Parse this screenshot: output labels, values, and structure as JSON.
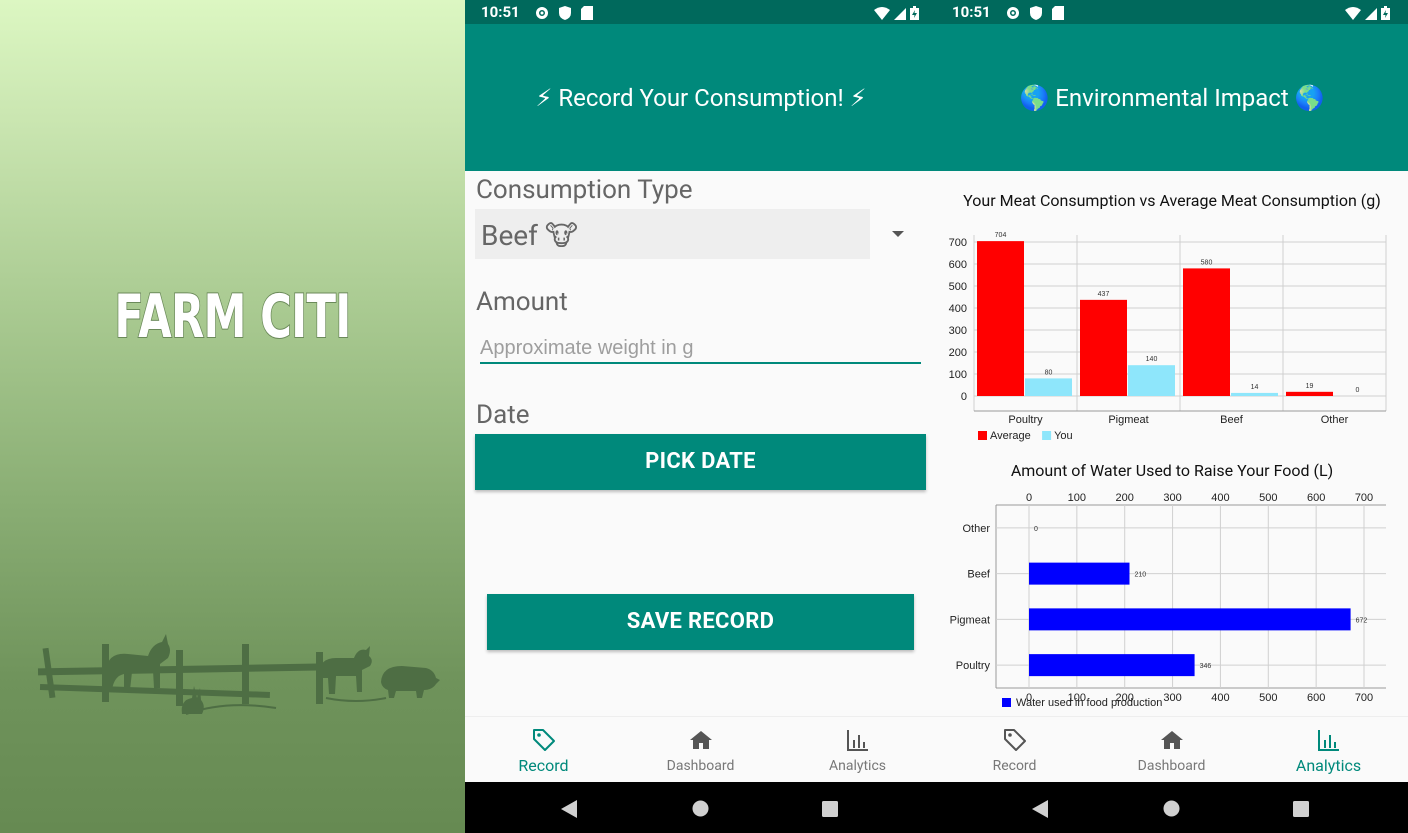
{
  "splash": {
    "app_title": "FARM CITI"
  },
  "status_bar": {
    "time": "10:51"
  },
  "record_screen": {
    "header_title": "⚡ Record Your Consumption! ⚡",
    "consumption_type_label": "Consumption Type",
    "consumption_type_value": "Beef 🐮",
    "amount_label": "Amount",
    "amount_placeholder": "Approximate weight in g",
    "amount_value": "",
    "date_label": "Date",
    "pick_date_button": "PICK DATE",
    "save_record_button": "SAVE RECORD"
  },
  "analytics_screen": {
    "header_title": "🌎 Environmental Impact 🌎"
  },
  "bottom_nav": {
    "items": [
      {
        "label": "Record",
        "icon": "tag-icon"
      },
      {
        "label": "Dashboard",
        "icon": "home-icon"
      },
      {
        "label": "Analytics",
        "icon": "bar-chart-icon"
      }
    ]
  },
  "colors": {
    "primary": "#00897b",
    "primary_dark": "#00695c",
    "average_bar": "#ff0000",
    "you_bar": "#8ee6fb",
    "water_bar": "#0000ff"
  },
  "chart_data": [
    {
      "type": "bar",
      "title": "Your Meat Consumption vs Average Meat Consumption (g)",
      "categories": [
        "Poultry",
        "Pigmeat",
        "Beef",
        "Other"
      ],
      "series": [
        {
          "name": "Average",
          "values": [
            704,
            437,
            580,
            19
          ],
          "color": "#ff0000"
        },
        {
          "name": "You",
          "values": [
            80,
            140,
            14,
            0
          ],
          "color": "#8ee6fb"
        }
      ],
      "ylim": [
        0,
        700
      ],
      "yticks": [
        0,
        100,
        200,
        300,
        400,
        500,
        600,
        700
      ],
      "grid": true,
      "legend": "bottom-left"
    },
    {
      "type": "bar",
      "orientation": "horizontal",
      "title": "Amount of Water Used to Raise Your Food (L)",
      "categories": [
        "Poultry",
        "Pigmeat",
        "Beef",
        "Other"
      ],
      "series": [
        {
          "name": "Water used in food production",
          "values": [
            346,
            672,
            210,
            0
          ],
          "color": "#0000ff"
        }
      ],
      "xlim": [
        0,
        700
      ],
      "xticks": [
        0,
        100,
        200,
        300,
        400,
        500,
        600,
        700
      ],
      "grid": true,
      "legend": "bottom-left"
    }
  ]
}
